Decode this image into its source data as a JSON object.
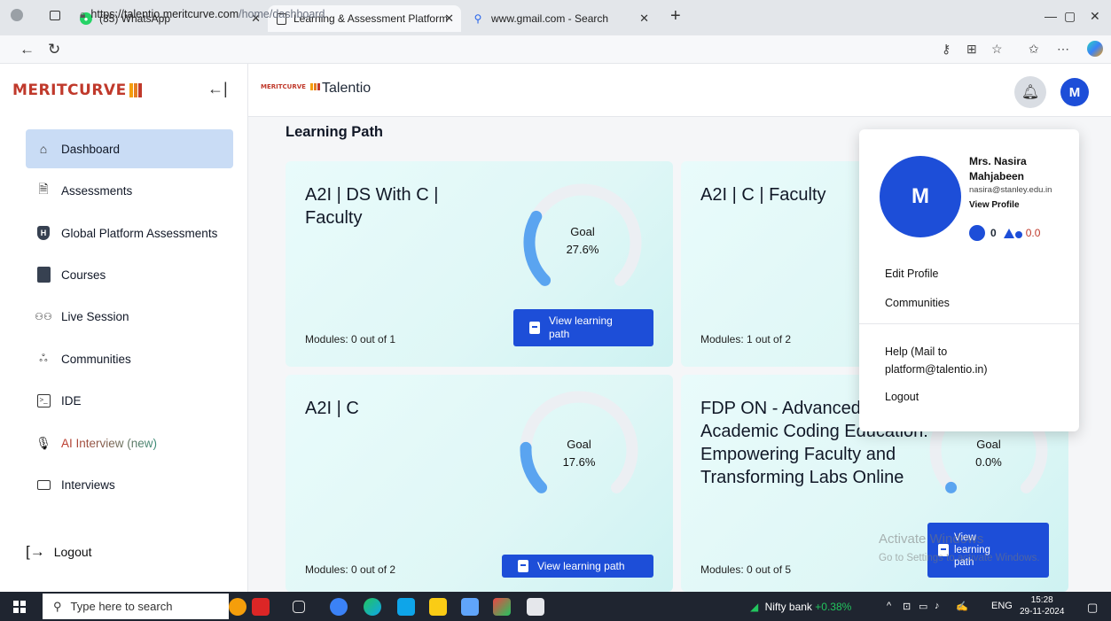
{
  "browser": {
    "tabs": [
      {
        "label": "(35) WhatsApp"
      },
      {
        "label": "Learning & Assessment Platform"
      },
      {
        "label": "www.gmail.com - Search"
      }
    ],
    "url_host": "https://talentio.meritcurve.com",
    "url_path": "/home/dashboard"
  },
  "app": {
    "logo_text": "MERITCURVE",
    "brand_small": "MERITCURVE",
    "brand_name": "Talentio",
    "avatar_letter": "M"
  },
  "sidebar": {
    "items": [
      {
        "label": "Dashboard",
        "icon": "home-icon"
      },
      {
        "label": "Assessments",
        "icon": "document-icon"
      },
      {
        "label": "Global Platform Assessments",
        "icon": "shield-icon"
      },
      {
        "label": "Courses",
        "icon": "book-icon"
      },
      {
        "label": "Live Session",
        "icon": "people-icon"
      },
      {
        "label": "Communities",
        "icon": "community-icon"
      },
      {
        "label": "IDE",
        "icon": "terminal-icon"
      },
      {
        "label": "AI Interview (new)",
        "icon": "microphone-icon"
      },
      {
        "label": "Interviews",
        "icon": "video-icon"
      }
    ],
    "logout_label": "Logout"
  },
  "main": {
    "section_title": "Learning Path",
    "cards": [
      {
        "title": "A2I | DS With C | Faculty",
        "goal_label": "Goal",
        "goal_value": "27.6%",
        "progress": 0.276,
        "modules": "Modules: 0 out of 1",
        "button": "View learning path"
      },
      {
        "title": "A2I | C | Faculty",
        "modules": "Modules: 1 out of 2"
      },
      {
        "title": "A2I | C",
        "goal_label": "Goal",
        "goal_value": "17.6%",
        "progress": 0.176,
        "modules": "Modules: 0 out of 2",
        "button": "View learning path"
      },
      {
        "title": "FDP ON - Advanced Academic Coding Education: Empowering Faculty and Transforming Labs Online",
        "goal_label": "Goal",
        "goal_value": "0.0%",
        "progress": 0.0,
        "modules": "Modules: 0 out of 5",
        "button": "View learning path"
      }
    ]
  },
  "profile_popup": {
    "avatar_letter": "M",
    "name": "Mrs. Nasira Mahjabeen",
    "email": "nasira@stanley.edu.in",
    "view_profile": "View Profile",
    "stat_points": "0",
    "stat_score": "0.0",
    "menu": {
      "edit_profile": "Edit Profile",
      "communities": "Communities",
      "help": "Help (Mail to platform@talentio.in)",
      "logout": "Logout"
    }
  },
  "watermark": {
    "line1": "Activate Windows",
    "line2": "Go to Settings to activate Windows."
  },
  "taskbar": {
    "search_placeholder": "Type here to search",
    "ticker_name": "Nifty bank",
    "ticker_change": "+0.38%",
    "language": "ENG",
    "time": "15:28",
    "date": "29-11-2024"
  },
  "colors": {
    "accent": "#1d4ed8",
    "active_nav": "#c9dcf5",
    "gauge_fill": "#5aa4f0",
    "gauge_track": "#eceff3",
    "brand_red": "#c0392b"
  }
}
